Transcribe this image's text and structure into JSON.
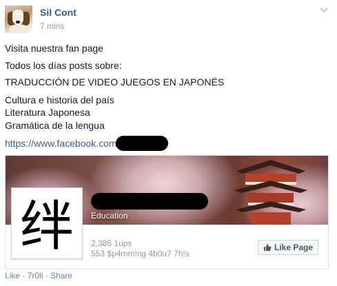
{
  "post": {
    "author": "Sil Cont",
    "time": "7 mins",
    "lines": [
      "Visita nuestra fan page",
      "Todos los días posts sobre:",
      "TRADUCCIÓN DE VIDEO JUEGOS EN JAPONÉS",
      "Cultura e historia del país",
      "Literatura Japonesa",
      "Gramática de la lengua"
    ],
    "link": "https://www.facebook.com"
  },
  "card": {
    "category": "Education",
    "page_photo_glyph": "绊",
    "likes": "2,386 1ups",
    "talking": "553 $p4mm!ng 4b0u7 7h!s",
    "like_button": "Like Page"
  },
  "actions": {
    "like": "Like",
    "troll": "7r0ll",
    "share": "Share",
    "separator": "·"
  },
  "icons": {
    "chevron": "chevron-down-icon",
    "thumb": "thumbs-up-icon"
  },
  "colors": {
    "link": "#3b5998",
    "meta": "#9197a3",
    "action": "#6d84b4"
  }
}
